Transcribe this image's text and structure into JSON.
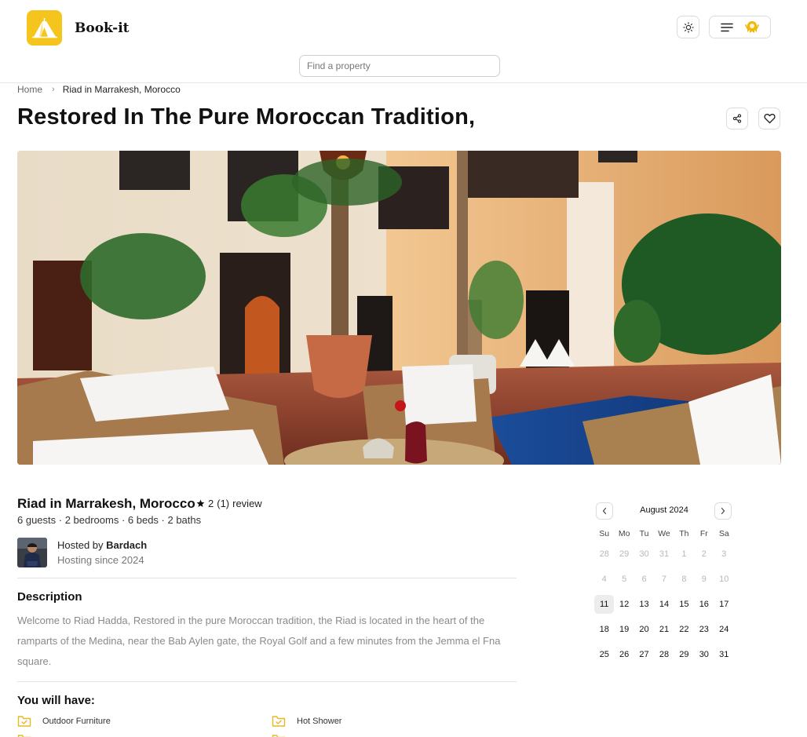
{
  "header": {
    "brand": "Book-it",
    "search_placeholder": "Find a property"
  },
  "breadcrumb": {
    "home": "Home",
    "current": "Riad in Marrakesh, Morocco"
  },
  "page_title": "Restored In The Pure Moroccan Tradition,",
  "listing": {
    "title": "Riad in Marrakesh, Morocco",
    "rating_value": "2",
    "rating_count": "(1)",
    "rating_word": "review",
    "specs": "6 guests · 2 bedrooms · 6 beds · 2 baths"
  },
  "host": {
    "prefix": "Hosted by",
    "name": "Bardach",
    "since": "Hosting since 2024"
  },
  "description": {
    "title": "Description",
    "text": "Welcome to Riad Hadda, Restored in the pure Moroccan tradition, the Riad is located in the heart of the ramparts of the Medina, near the Bab Aylen gate, the Royal Golf and a few minutes from the Jemma el Fna square."
  },
  "amenities": {
    "title": "You will have:",
    "items": [
      "Outdoor Furniture",
      "Hot Shower"
    ]
  },
  "calendar": {
    "month": "August 2024",
    "weekdays": [
      "Su",
      "Mo",
      "Tu",
      "We",
      "Th",
      "Fr",
      "Sa"
    ],
    "weeks": [
      [
        "28",
        "29",
        "30",
        "31",
        "1",
        "2",
        "3"
      ],
      [
        "4",
        "5",
        "6",
        "7",
        "8",
        "9",
        "10"
      ],
      [
        "11",
        "12",
        "13",
        "14",
        "15",
        "16",
        "17"
      ],
      [
        "18",
        "19",
        "20",
        "21",
        "22",
        "23",
        "24"
      ],
      [
        "25",
        "26",
        "27",
        "28",
        "29",
        "30",
        "31"
      ]
    ],
    "muted_rows": [
      0,
      1
    ],
    "today": "11"
  },
  "colors": {
    "brand_yellow": "#f6c51d",
    "amenity_icon": "#e8b820"
  },
  "icons": {
    "logo": "tent-icon",
    "theme": "sun-icon",
    "menu": "menu-icon",
    "share": "share-icon",
    "favorite": "heart-icon",
    "rating": "star-icon",
    "amenity": "folder-check-icon"
  }
}
